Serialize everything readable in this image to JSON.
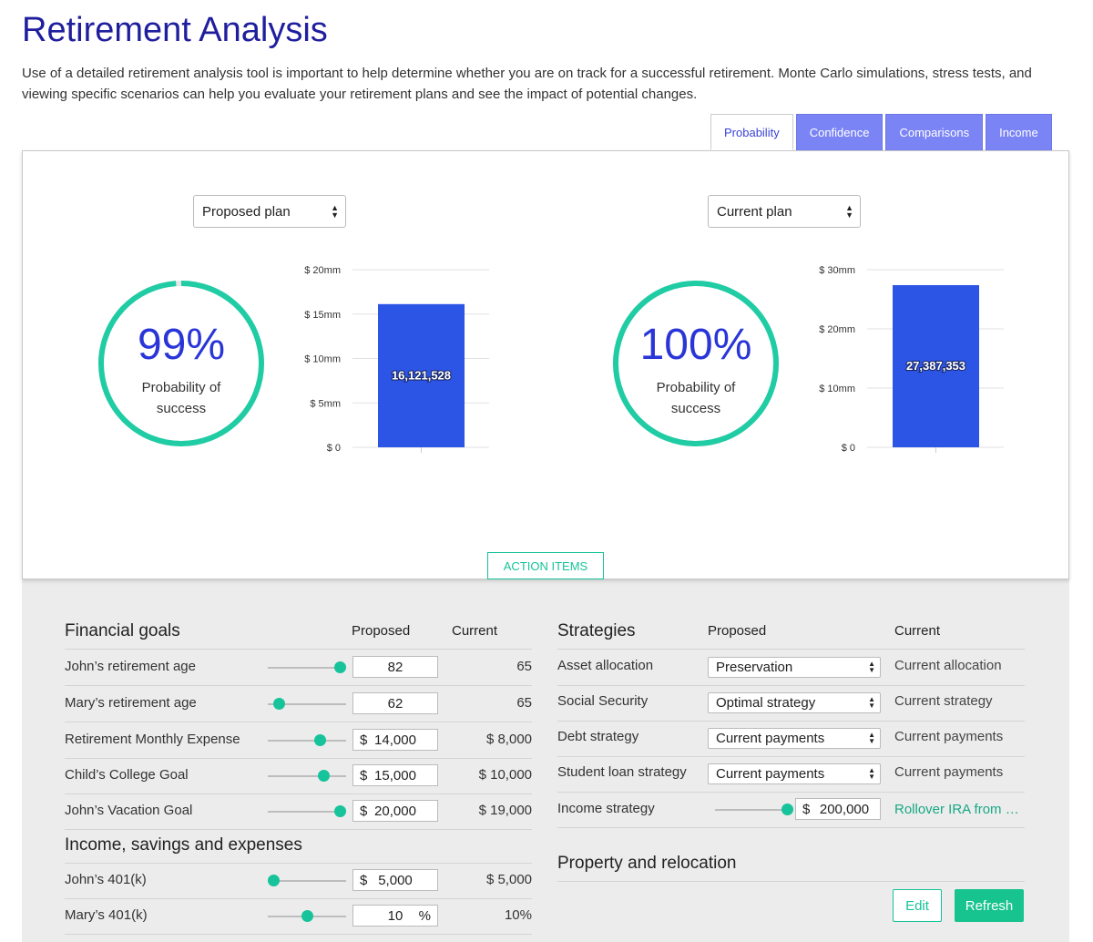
{
  "page": {
    "title": "Retirement Analysis",
    "description": "Use of a detailed retirement analysis tool is important to help determine whether you are on track for a successful retirement. Monte Carlo simulations, stress tests, and viewing specific scenarios can help you evaluate your retirement plans and see the impact of potential changes."
  },
  "tabs": [
    {
      "label": "Probability",
      "active": true
    },
    {
      "label": "Confidence",
      "active": false
    },
    {
      "label": "Comparisons",
      "active": false
    },
    {
      "label": "Income",
      "active": false
    }
  ],
  "panels": [
    {
      "plan_select": "Proposed plan",
      "probability_pct": "99%",
      "probability_fraction": 0.99,
      "probability_label_line1": "Probability of",
      "probability_label_line2": "success"
    },
    {
      "plan_select": "Current plan",
      "probability_pct": "100%",
      "probability_fraction": 1.0,
      "probability_label_line1": "Probability of",
      "probability_label_line2": "success"
    }
  ],
  "chart_data": [
    {
      "type": "bar",
      "categories": [
        ""
      ],
      "values": [
        16121528
      ],
      "data_labels": [
        "16,121,528"
      ],
      "ylim": [
        0,
        20000000
      ],
      "yticks": [
        0,
        5000000,
        10000000,
        15000000,
        20000000
      ],
      "ytick_labels": [
        "$ 0",
        "$ 5mm",
        "$ 10mm",
        "$ 15mm",
        "$ 20mm"
      ],
      "grid": true,
      "color": "#2c55e6"
    },
    {
      "type": "bar",
      "categories": [
        ""
      ],
      "values": [
        27387353
      ],
      "data_labels": [
        "27,387,353"
      ],
      "ylim": [
        0,
        30000000
      ],
      "yticks": [
        0,
        10000000,
        20000000,
        30000000
      ],
      "ytick_labels": [
        "$ 0",
        "$ 10mm",
        "$ 20mm",
        "$ 30mm"
      ],
      "grid": true,
      "color": "#2c55e6"
    }
  ],
  "action_items_label": "ACTION ITEMS",
  "financial_goals": {
    "title": "Financial goals",
    "col_proposed": "Proposed",
    "col_current": "Current",
    "rows": [
      {
        "label": "John’s retirement age",
        "currency": "",
        "proposed": "82",
        "unit": "",
        "current": "65",
        "slider": 0.93
      },
      {
        "label": "Mary’s retirement age",
        "currency": "",
        "proposed": "62",
        "unit": "",
        "current": "65",
        "slider": 0.15
      },
      {
        "label": "Retirement Monthly Expense",
        "currency": "$",
        "proposed": "14,000",
        "unit": "",
        "current": "$ 8,000",
        "slider": 0.67
      },
      {
        "label": "Child’s College Goal",
        "currency": "$",
        "proposed": "15,000",
        "unit": "",
        "current": "$ 10,000",
        "slider": 0.72
      },
      {
        "label": "John’s Vacation Goal",
        "currency": "$",
        "proposed": "20,000",
        "unit": "",
        "current": "$ 19,000",
        "slider": 0.93
      }
    ]
  },
  "income_savings": {
    "title": "Income, savings and expenses",
    "rows": [
      {
        "label": "John’s 401(k)",
        "currency": "$",
        "proposed": "5,000",
        "unit": "",
        "current": "$ 5,000",
        "slider": 0.07
      },
      {
        "label": "Mary’s 401(k)",
        "currency": "",
        "proposed": "10",
        "unit": "%",
        "current": "10%",
        "slider": 0.51
      }
    ]
  },
  "strategies": {
    "title": "Strategies",
    "col_proposed": "Proposed",
    "col_current": "Current",
    "rows": [
      {
        "label": "Asset allocation",
        "proposed": "Preservation",
        "current": "Current allocation"
      },
      {
        "label": "Social Security",
        "proposed": "Optimal strategy",
        "current": "Current strategy"
      },
      {
        "label": "Debt strategy",
        "proposed": "Current payments",
        "current": "Current payments"
      },
      {
        "label": "Student loan strategy",
        "proposed": "Current payments",
        "current": "Current payments"
      }
    ],
    "income_strategy": {
      "label": "Income strategy",
      "currency": "$",
      "proposed": "200,000",
      "current": "Rollover IRA from …",
      "slider": 0.98
    }
  },
  "property_relocation": {
    "title": "Property and relocation"
  },
  "buttons": {
    "edit": "Edit",
    "refresh": "Refresh"
  },
  "colors": {
    "title": "#1f1f9e",
    "accent_green": "#17c39a",
    "bar_blue": "#2c55e6",
    "tab_blue": "#7b84f5",
    "percent_blue": "#2a35d8"
  }
}
